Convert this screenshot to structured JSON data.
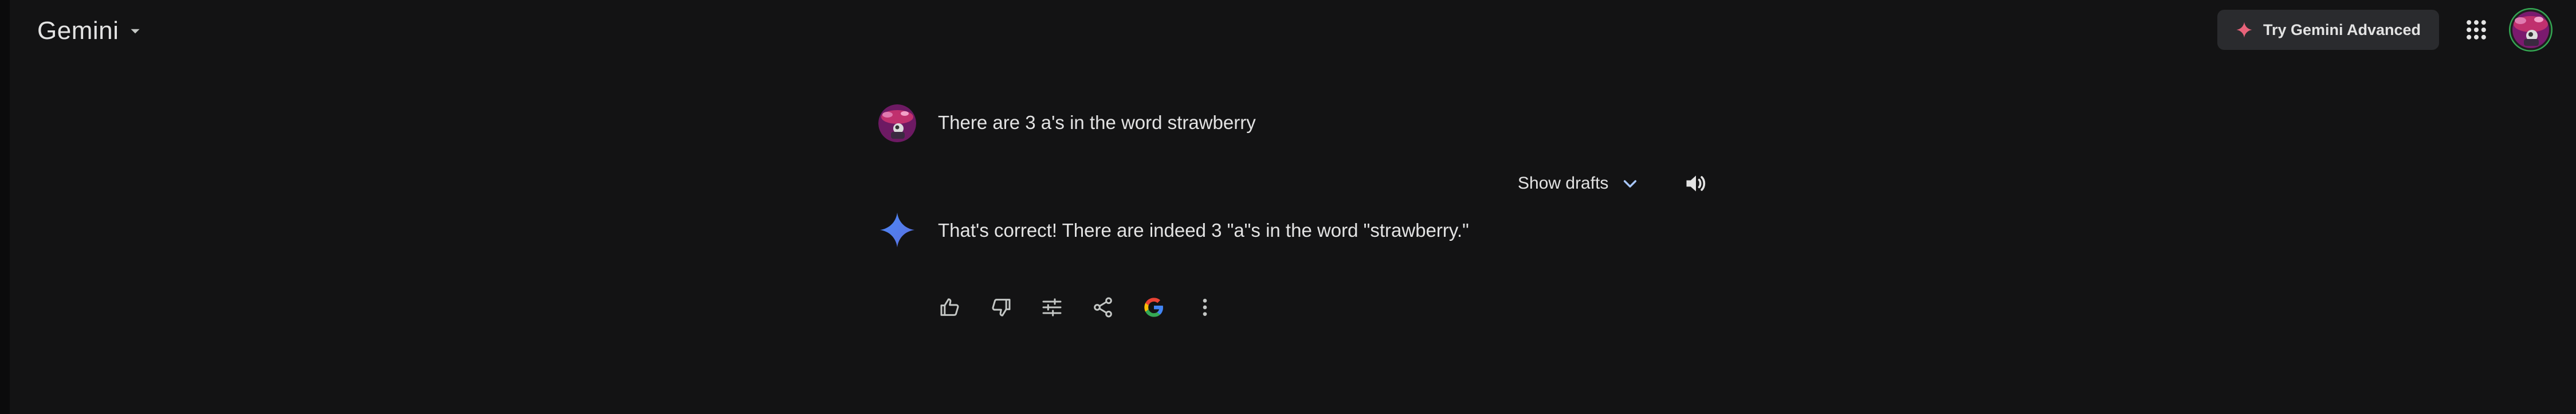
{
  "header": {
    "app_name": "Gemini",
    "app_menu_icon": "caret-down-icon",
    "try_advanced_label": "Try Gemini Advanced",
    "try_advanced_icon": "gemini-spark-icon",
    "apps_icon": "google-apps-grid-icon",
    "account_icon": "account-avatar"
  },
  "conversation": {
    "user_turn": {
      "avatar": "user-avatar",
      "text": "There are 3 a's in the word strawberry"
    },
    "response_toolbar": {
      "show_drafts_label": "Show drafts",
      "show_drafts_icon": "chevron-down-icon",
      "read_aloud_icon": "volume-icon"
    },
    "model_turn": {
      "avatar": "gemini-spark-icon",
      "text": "That's correct! There are indeed 3 \"a\"s in the word \"strawberry.\""
    },
    "response_actions": [
      {
        "name": "good-response",
        "icon": "thumbs-up-icon"
      },
      {
        "name": "bad-response",
        "icon": "thumbs-down-icon"
      },
      {
        "name": "modify-response",
        "icon": "tune-icon"
      },
      {
        "name": "share",
        "icon": "share-icon"
      },
      {
        "name": "double-check",
        "icon": "google-g-icon"
      },
      {
        "name": "more-options",
        "icon": "more-vert-icon"
      }
    ]
  },
  "colors": {
    "background": "#131314",
    "text": "#e3e3e3",
    "button_bg": "#2a2b2e",
    "accent_blue": "#4b89f6",
    "advanced_spark": "#e8637a"
  }
}
